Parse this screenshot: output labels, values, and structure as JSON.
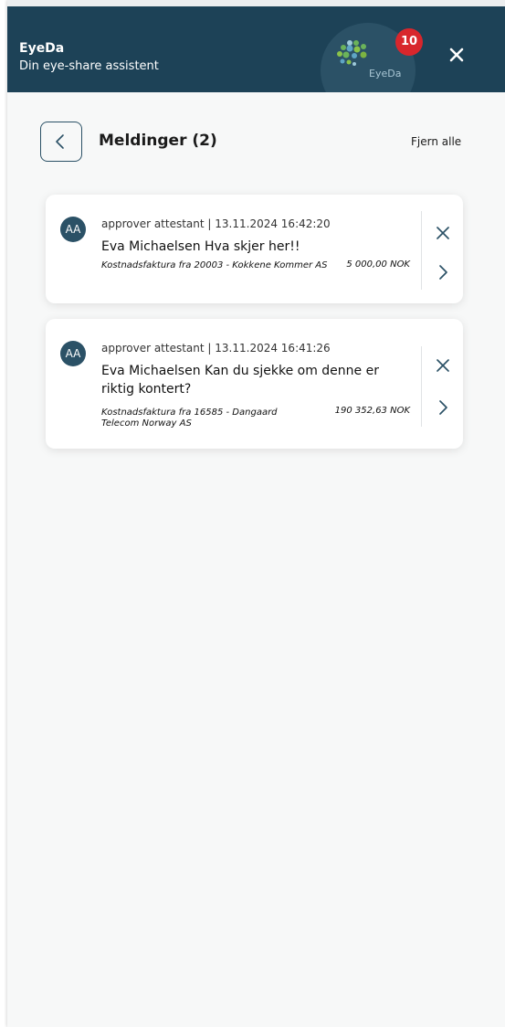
{
  "header": {
    "title": "EyeDa",
    "subtitle": "Din eye-share assistent",
    "logo_text": "EyeDa",
    "badge_count": "10",
    "colors": {
      "background": "#1d4257",
      "badge": "#d8262c"
    }
  },
  "messages_page": {
    "title": "Meldinger (2)",
    "remove_all_label": "Fjern alle"
  },
  "messages": [
    {
      "avatar_initials": "AA",
      "meta": "approver attestant | 13.11.2024 16:42:20",
      "text": "Eva Michaelsen Hva skjer her!!",
      "invoice": "Kostnadsfaktura fra 20003 - Kokkene Kommer AS",
      "amount": "5 000,00 NOK"
    },
    {
      "avatar_initials": "AA",
      "meta": "approver attestant | 13.11.2024 16:41:26",
      "text": "Eva Michaelsen Kan du sjekke om denne er riktig kontert?",
      "invoice": "Kostnadsfaktura fra 16585 - Dangaard Telecom Norway AS",
      "amount": "190 352,63 NOK"
    }
  ],
  "icons": {
    "close": "close-icon",
    "back": "chevron-left-icon",
    "open": "chevron-right-icon",
    "logo": "eyeda-logo-icon"
  }
}
